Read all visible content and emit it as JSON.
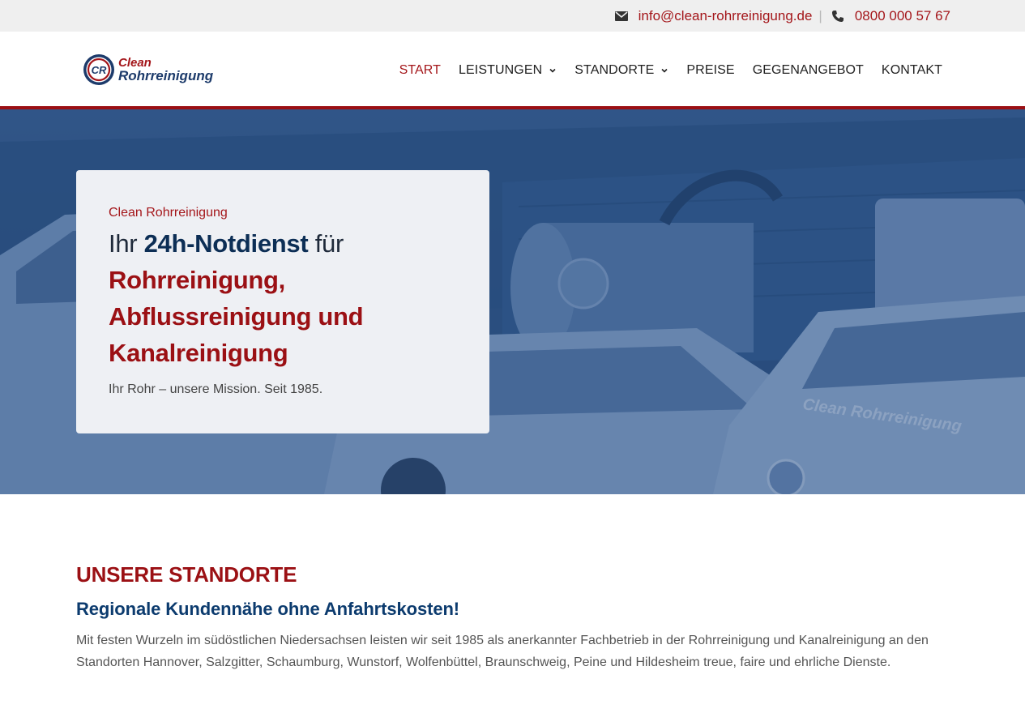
{
  "topbar": {
    "email": "info@clean-rohrreinigung.de",
    "phone": "0800 000 57 67",
    "separator": "|",
    "email_icon": "envelope-icon",
    "phone_icon": "phone-icon"
  },
  "logo": {
    "line1": "Clean",
    "line2": "Rohrreinigung",
    "mark_text": "CR"
  },
  "nav": {
    "items": [
      {
        "label": "START",
        "active": true
      },
      {
        "label": "LEISTUNGEN",
        "dropdown": true
      },
      {
        "label": "STANDORTE",
        "dropdown": true
      },
      {
        "label": "PREISE"
      },
      {
        "label": "GEGENANGEBOT"
      },
      {
        "label": "KONTAKT"
      }
    ]
  },
  "hero": {
    "kicker": "Clean Rohrreinigung",
    "title_part1": "Ihr ",
    "title_highlight": "24h-Notdienst",
    "title_part2": " für",
    "title_line2": "Rohrreinigung,",
    "title_line3_a": "Abflussreinigung",
    "title_line3_b": " und",
    "title_line4": "Kanalreinigung",
    "subtitle": "Ihr Rohr – unsere Mission. Seit 1985.",
    "bg_brand_text": "Clean Rohrreinigung"
  },
  "section": {
    "heading": "UNSERE STANDORTE",
    "subheading": "Regionale Kundennähe ohne Anfahrtskosten!",
    "body": "Mit festen Wurzeln im südöstlichen Niedersachsen leisten wir seit 1985 als anerkannter Fachbetrieb in der Rohrreinigung und Kanalreinigung an den Standorten Hannover, Salzgitter, Schaumburg, Wunstorf, Wolfenbüttel, Braunschweig, Peine und Hildesheim treue, faire und ehrliche Dienste."
  },
  "colors": {
    "brand_red": "#9b1014",
    "brand_blue": "#0c2e55",
    "hero_overlay": "#2b4d7a",
    "topbar_bg": "#efefef"
  }
}
